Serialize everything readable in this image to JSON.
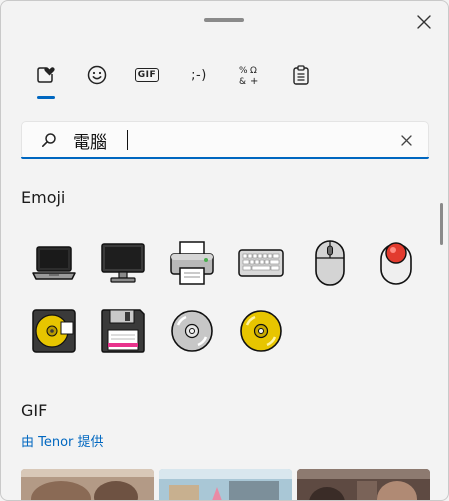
{
  "panel": {
    "tabs": [
      {
        "name": "tab-emoji",
        "icon": "heart-sticker-icon"
      },
      {
        "name": "tab-smileys",
        "icon": "smiley-icon"
      },
      {
        "name": "tab-gif",
        "label": "GIF"
      },
      {
        "name": "tab-kaomoji",
        "label": ";-)"
      },
      {
        "name": "tab-symbols",
        "label": "%Ω&+",
        "icon": "symbols-icon"
      },
      {
        "name": "tab-clipboard",
        "icon": "clipboard-icon"
      }
    ],
    "active_tab": "tab-emoji"
  },
  "search": {
    "value": "電腦",
    "icon": "search-icon",
    "clear_icon": "close-icon"
  },
  "emoji_section": {
    "title": "Emoji",
    "items": [
      {
        "name": "laptop-emoji"
      },
      {
        "name": "desktop-computer-emoji"
      },
      {
        "name": "printer-emoji"
      },
      {
        "name": "keyboard-emoji"
      },
      {
        "name": "computer-mouse-emoji"
      },
      {
        "name": "trackball-emoji"
      },
      {
        "name": "minidisc-emoji"
      },
      {
        "name": "floppy-disk-emoji"
      },
      {
        "name": "optical-disc-emoji"
      },
      {
        "name": "dvd-emoji"
      }
    ]
  },
  "gif_section": {
    "title": "GIF",
    "provider": "由 Tenor 提供"
  },
  "colors": {
    "accent": "#0067c0",
    "background": "#f3f3f3"
  }
}
